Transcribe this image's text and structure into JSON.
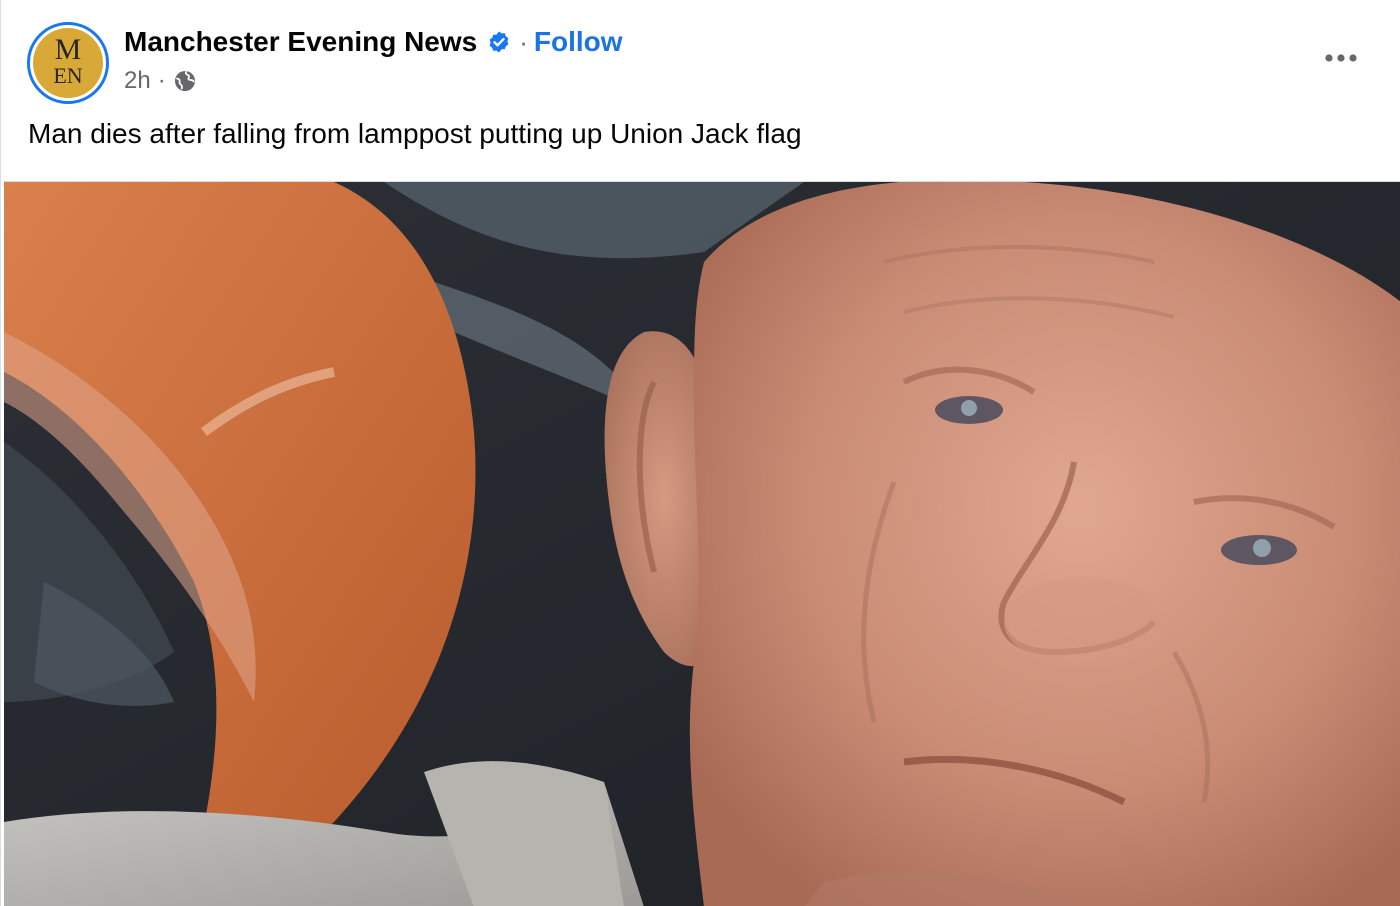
{
  "post": {
    "page_name": "Manchester Evening News",
    "follow_label": "Follow",
    "separator": "·",
    "timestamp": "2h",
    "caption": "Man dies after falling from lamppost putting up Union Jack flag"
  },
  "avatar": {
    "line1": "M",
    "line2": "EN"
  },
  "icons": {
    "verified": "verified-badge-icon",
    "audience": "globe-icon",
    "more": "more-options-icon"
  },
  "colors": {
    "link_blue": "#1b74e4",
    "verified_blue": "#1877f2",
    "avatar_gold": "#d8a937",
    "text_primary": "#050505",
    "text_secondary": "#65676b"
  }
}
